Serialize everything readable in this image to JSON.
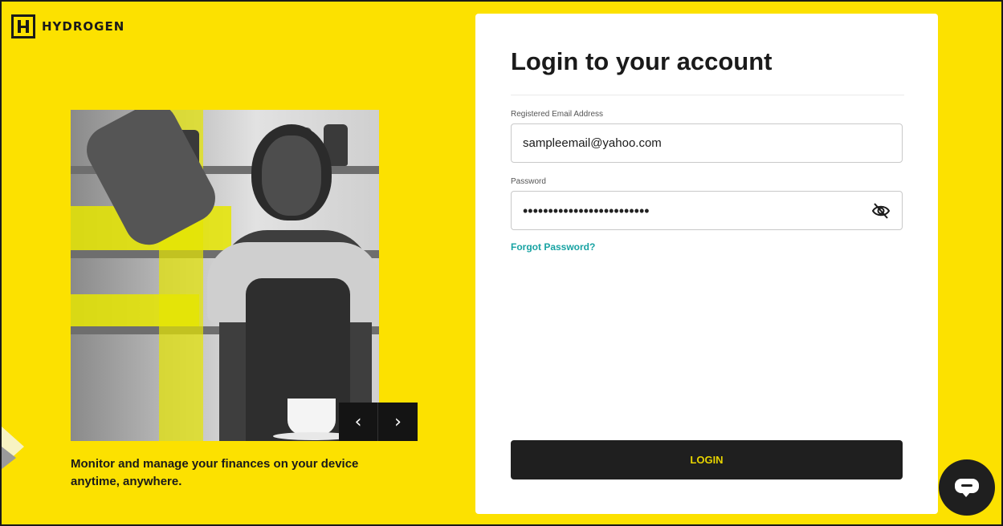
{
  "brand": {
    "name": "HYDROGEN"
  },
  "hero": {
    "tagline": "Monitor and manage your finances on your device anytime, anywhere.",
    "prev_glyph": "‹",
    "next_glyph": "›"
  },
  "login": {
    "title": "Login to your account",
    "email_label": "Registered Email Address",
    "email_value": "sampleemail@yahoo.com",
    "password_label": "Password",
    "password_masked": "•••••••••••••••••••••••••",
    "forgot_label": "Forgot Password?",
    "submit_label": "LOGIN"
  },
  "icons": {
    "logo": "hydrogen-logo-icon",
    "toggle_password": "eye-off-icon",
    "chat": "chat-bubble-icon"
  },
  "colors": {
    "background": "#fce100",
    "button": "#1f1f1f",
    "button_text": "#e8d400",
    "link": "#18a3a3"
  }
}
